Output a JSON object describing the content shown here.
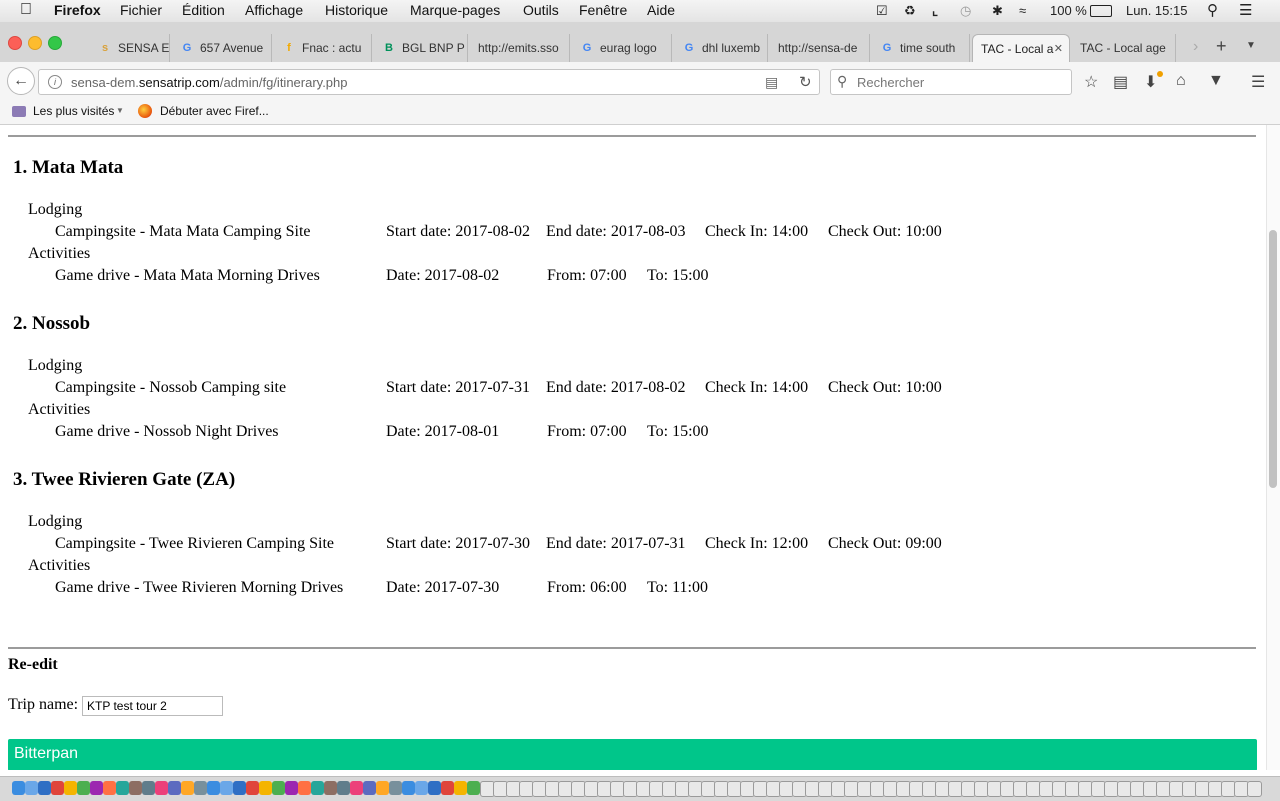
{
  "menubar": {
    "apple": "",
    "app": "Firefox",
    "items": [
      "Fichier",
      "Édition",
      "Affichage",
      "Historique",
      "Marque-pages",
      "Outils",
      "Fenêtre",
      "Aide"
    ],
    "battery": "100 %",
    "clock": "Lun. 15:15"
  },
  "tabs": [
    {
      "label": "SENSA EPP",
      "fav": "s",
      "color": "#d9a23b"
    },
    {
      "label": "657 Avenue",
      "fav": "G",
      "color": "#4285f4"
    },
    {
      "label": "Fnac : actu",
      "fav": "f",
      "color": "#f2a900"
    },
    {
      "label": "BGL BNP P",
      "fav": "B",
      "color": "#00915a"
    },
    {
      "label": "http://emits.sso",
      "fav": "",
      "color": "#888888"
    },
    {
      "label": "eurag logo",
      "fav": "G",
      "color": "#4285f4"
    },
    {
      "label": "dhl luxemb",
      "fav": "G",
      "color": "#4285f4"
    },
    {
      "label": "http://sensa-de",
      "fav": "",
      "color": "#888888"
    },
    {
      "label": "time south",
      "fav": "G",
      "color": "#4285f4"
    },
    {
      "label": "TAC - Local a",
      "fav": "",
      "color": "#888888",
      "active": true
    },
    {
      "label": "TAC - Local age",
      "fav": "",
      "color": "#888888"
    }
  ],
  "nav": {
    "url_prefix": "sensa-dem.",
    "url_domain": "sensatrip.com",
    "url_path": "/admin/fg/itinerary.php",
    "search_placeholder": "Rechercher"
  },
  "bookmarks": {
    "most_visited": "Les plus visités",
    "getting_started": "Débuter avec Firef..."
  },
  "itinerary": [
    {
      "title": "1. Mata Mata",
      "lodging_label": "Lodging",
      "lodging_name": "Campingsite - Mata Mata Camping Site",
      "start": "Start date: 2017-08-02",
      "end": "End date: 2017-08-03",
      "checkin": "Check In: 14:00",
      "checkout": "Check Out: 10:00",
      "activities_label": "Activities",
      "activity_name": "Game drive - Mata Mata Morning Drives",
      "date": "Date: 2017-08-02",
      "from": "From: 07:00",
      "to": "To: 15:00"
    },
    {
      "title": "2. Nossob",
      "lodging_label": "Lodging",
      "lodging_name": "Campingsite - Nossob Camping site",
      "start": "Start date: 2017-07-31",
      "end": "End date: 2017-08-02",
      "checkin": "Check In: 14:00",
      "checkout": "Check Out: 10:00",
      "activities_label": "Activities",
      "activity_name": "Game drive - Nossob Night Drives",
      "date": "Date: 2017-08-01",
      "from": "From: 07:00",
      "to": "To: 15:00"
    },
    {
      "title": "3. Twee Rivieren Gate (ZA)",
      "lodging_label": "Lodging",
      "lodging_name": "Campingsite - Twee Rivieren Camping Site",
      "start": "Start date: 2017-07-30",
      "end": "End date: 2017-07-31",
      "checkin": "Check In: 12:00",
      "checkout": "Check Out: 09:00",
      "activities_label": "Activities",
      "activity_name": "Game drive - Twee Rivieren Morning Drives",
      "date": "Date: 2017-07-30",
      "from": "From: 06:00",
      "to": "To: 11:00"
    }
  ],
  "reedit": {
    "heading": "Re-edit",
    "trip_label": "Trip name:",
    "trip_value": "KTP test tour 2",
    "submit_label": "Bitterpan"
  },
  "colors": {
    "accent": "#00c68a",
    "separator": "#9b9b9b"
  }
}
